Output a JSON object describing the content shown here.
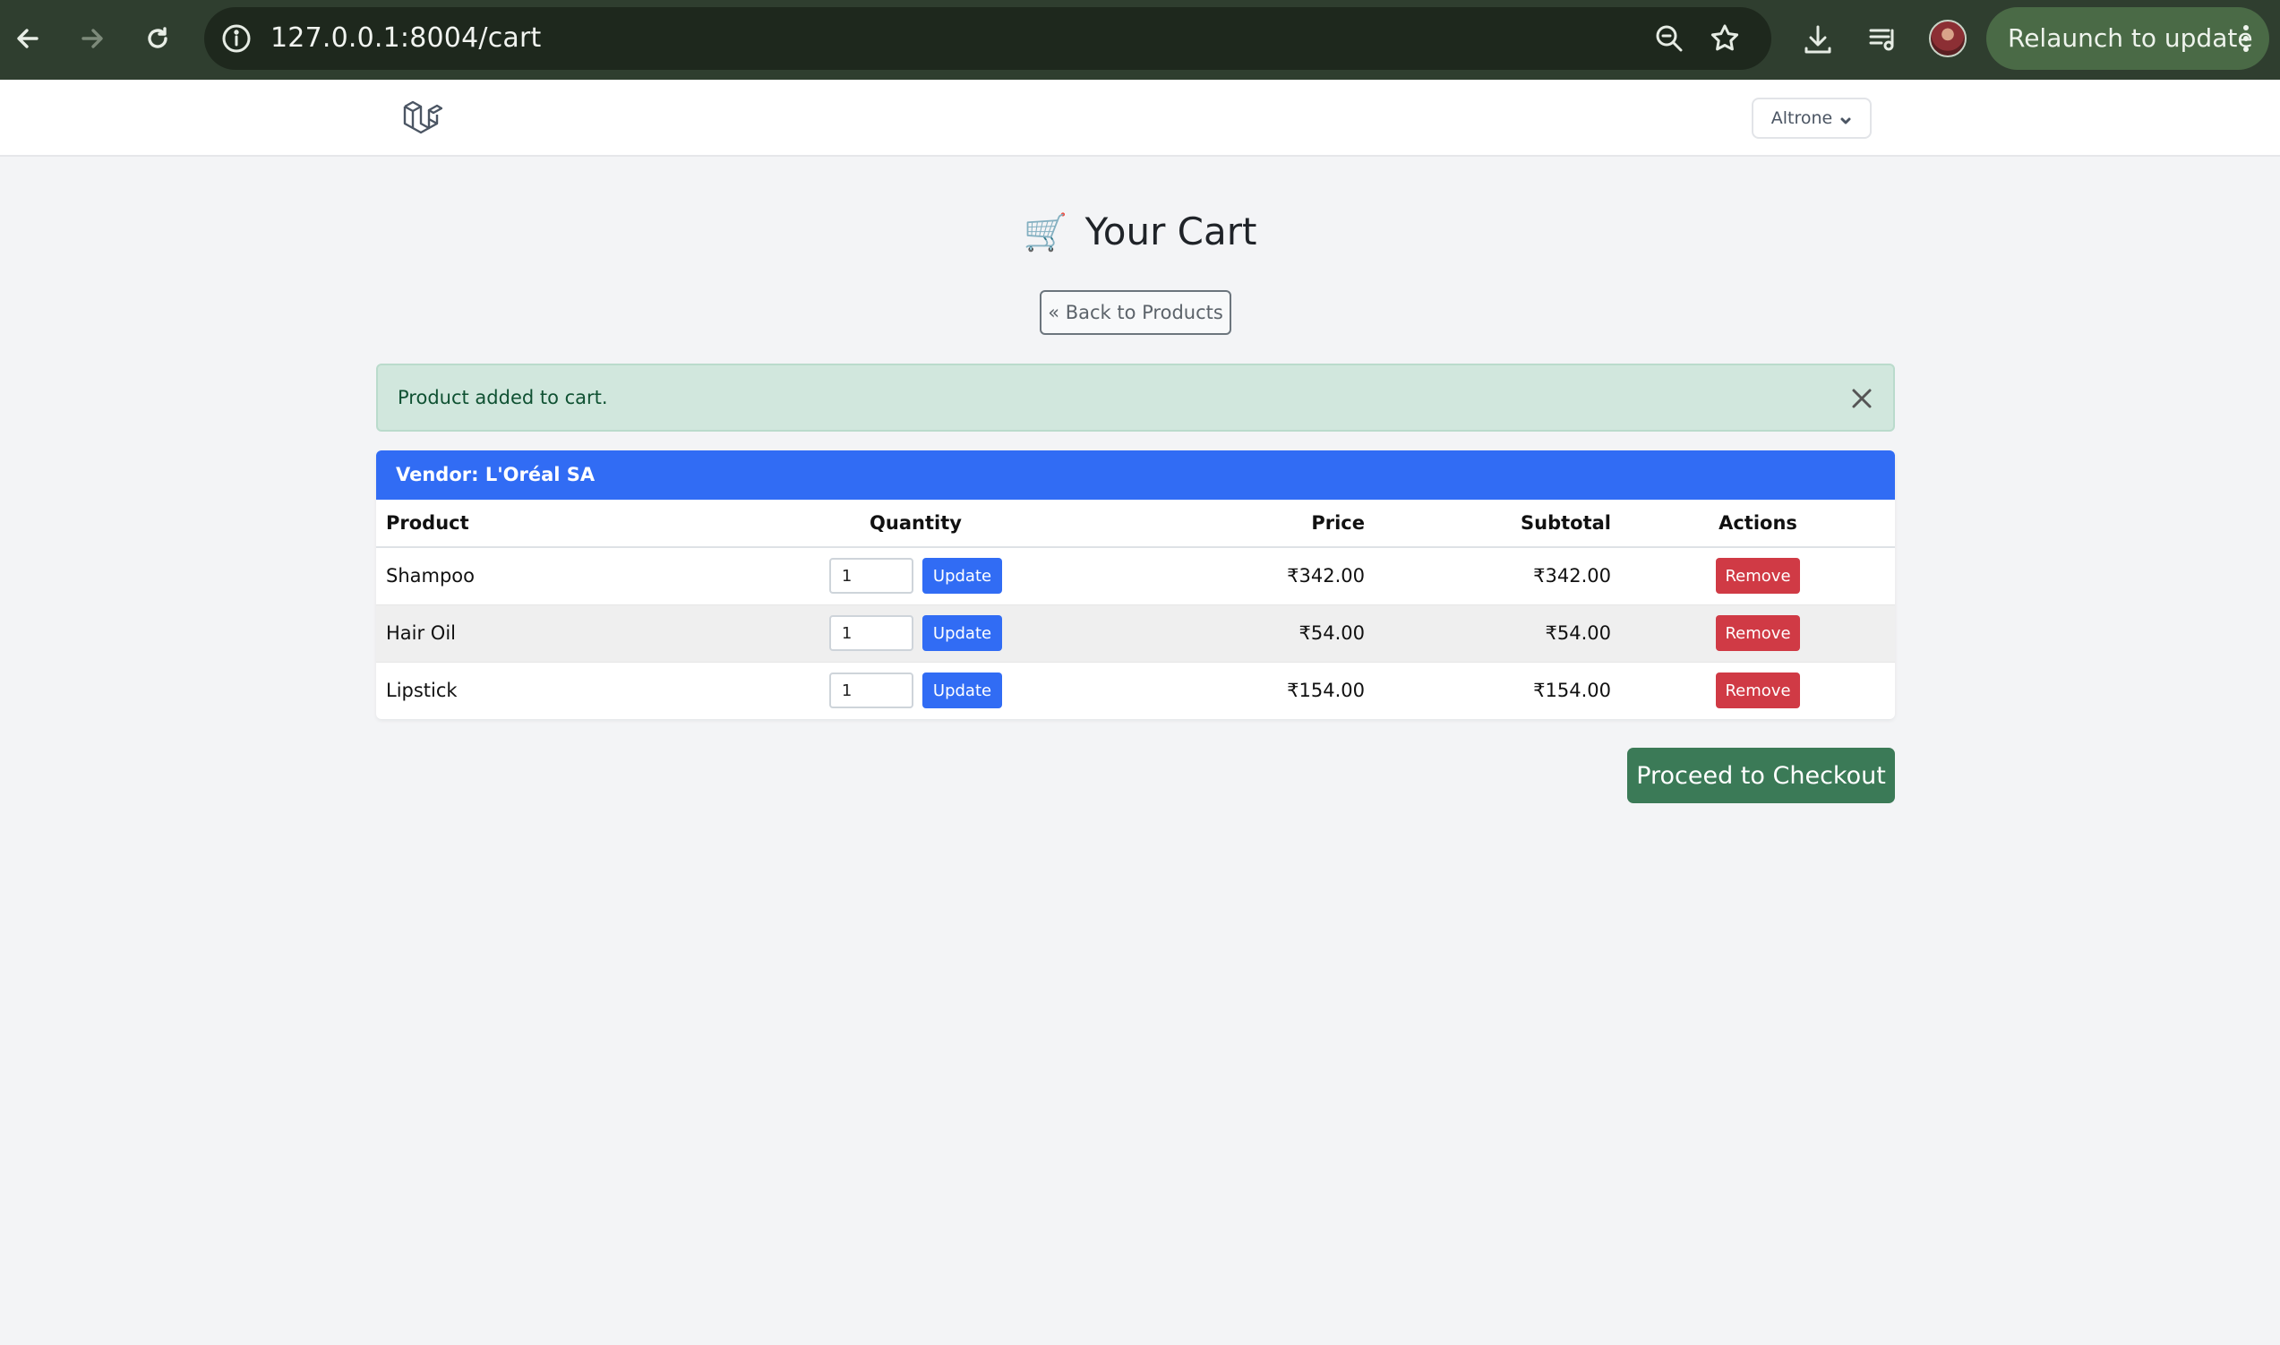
{
  "browser": {
    "url": "127.0.0.1:8004/cart",
    "relaunch_label": "Relaunch to update",
    "icons": [
      "back-icon",
      "forward-icon",
      "reload-icon",
      "info-icon",
      "zoom-icon",
      "bookmark-star-icon",
      "download-icon",
      "media-queue-icon",
      "profile-avatar",
      "kebab-menu-icon"
    ]
  },
  "header": {
    "logo": "laravel-logo-icon",
    "user_name": "Altrone"
  },
  "page": {
    "title_icon": "🛒",
    "title": "Your Cart",
    "back_label": "« Back to Products"
  },
  "alert": {
    "message": "Product added to cart.",
    "type": "success"
  },
  "vendor": {
    "header": "Vendor: L'Oréal SA",
    "columns": {
      "product": "Product",
      "quantity": "Quantity",
      "price": "Price",
      "subtotal": "Subtotal",
      "actions": "Actions"
    },
    "update_label": "Update",
    "remove_label": "Remove",
    "items": [
      {
        "product": "Shampoo",
        "quantity": "1",
        "price": "₹342.00",
        "subtotal": "₹342.00"
      },
      {
        "product": "Hair Oil",
        "quantity": "1",
        "price": "₹54.00",
        "subtotal": "₹54.00"
      },
      {
        "product": "Lipstick",
        "quantity": "1",
        "price": "₹154.00",
        "subtotal": "₹154.00"
      }
    ]
  },
  "checkout_label": "Proceed to Checkout",
  "colors": {
    "chrome_bg": "#2f3e2f",
    "primary": "#316cf4",
    "danger": "#d03a45",
    "success": "#3b7a57",
    "alert_bg": "#d1e7dd"
  }
}
